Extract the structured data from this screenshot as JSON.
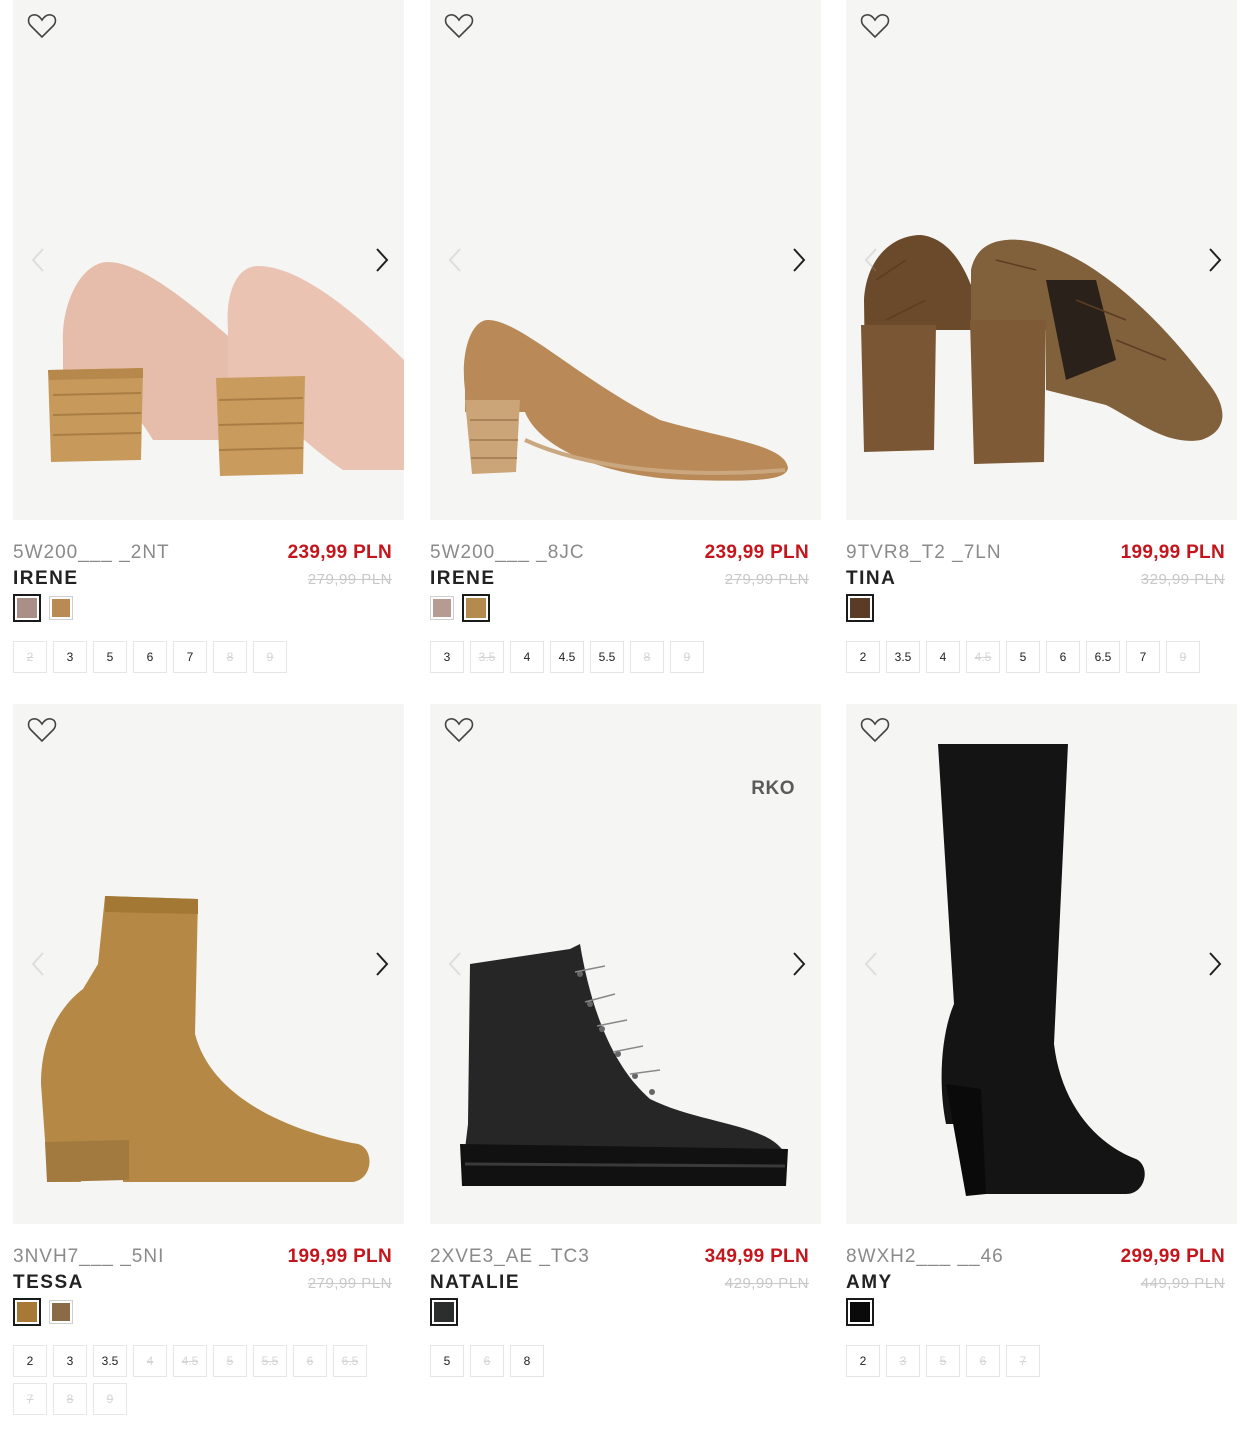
{
  "products": [
    {
      "code": "5W200___ _2NT",
      "name": "IRENE",
      "price": "239,99 PLN",
      "old_price": "279,99 PLN",
      "brand_badge": "",
      "swatches": [
        {
          "color": "#a98f88",
          "selected": true
        },
        {
          "color": "#b98a53",
          "selected": false
        }
      ],
      "sizes": [
        {
          "label": "2",
          "available": false
        },
        {
          "label": "3",
          "available": true
        },
        {
          "label": "5",
          "available": true
        },
        {
          "label": "6",
          "available": true
        },
        {
          "label": "7",
          "available": true
        },
        {
          "label": "8",
          "available": false
        },
        {
          "label": "9",
          "available": false
        }
      ]
    },
    {
      "code": "5W200___ _8JC",
      "name": "IRENE",
      "price": "239,99 PLN",
      "old_price": "279,99 PLN",
      "brand_badge": "",
      "swatches": [
        {
          "color": "#b69b93",
          "selected": false
        },
        {
          "color": "#b58a4f",
          "selected": true
        }
      ],
      "sizes": [
        {
          "label": "3",
          "available": true
        },
        {
          "label": "3.5",
          "available": false
        },
        {
          "label": "4",
          "available": true
        },
        {
          "label": "4.5",
          "available": true
        },
        {
          "label": "5.5",
          "available": true
        },
        {
          "label": "8",
          "available": false
        },
        {
          "label": "9",
          "available": false
        }
      ]
    },
    {
      "code": "9TVR8_T2 _7LN",
      "name": "TINA",
      "price": "199,99 PLN",
      "old_price": "329,99 PLN",
      "brand_badge": "",
      "swatches": [
        {
          "color": "#5a3b26",
          "selected": true
        }
      ],
      "sizes": [
        {
          "label": "2",
          "available": true
        },
        {
          "label": "3.5",
          "available": true
        },
        {
          "label": "4",
          "available": true
        },
        {
          "label": "4.5",
          "available": false
        },
        {
          "label": "5",
          "available": true
        },
        {
          "label": "6",
          "available": true
        },
        {
          "label": "6.5",
          "available": true
        },
        {
          "label": "7",
          "available": true
        },
        {
          "label": "9",
          "available": false
        }
      ]
    },
    {
      "code": "3NVH7___ _5NI",
      "name": "TESSA",
      "price": "199,99 PLN",
      "old_price": "279,99 PLN",
      "brand_badge": "",
      "swatches": [
        {
          "color": "#a77836",
          "selected": true
        },
        {
          "color": "#8b6a46",
          "selected": false
        }
      ],
      "sizes": [
        {
          "label": "2",
          "available": true
        },
        {
          "label": "3",
          "available": true
        },
        {
          "label": "3.5",
          "available": true
        },
        {
          "label": "4",
          "available": false
        },
        {
          "label": "4.5",
          "available": false
        },
        {
          "label": "5",
          "available": false
        },
        {
          "label": "5.5",
          "available": false
        },
        {
          "label": "6",
          "available": false
        },
        {
          "label": "6.5",
          "available": false
        },
        {
          "label": "7",
          "available": false
        },
        {
          "label": "8",
          "available": false
        },
        {
          "label": "9",
          "available": false
        }
      ]
    },
    {
      "code": "2XVE3_AE _TC3",
      "name": "NATALIE",
      "price": "349,99 PLN",
      "old_price": "429,99 PLN",
      "brand_badge": "RKO",
      "swatches": [
        {
          "color": "#2b2e2c",
          "selected": true
        }
      ],
      "sizes": [
        {
          "label": "5",
          "available": true
        },
        {
          "label": "6",
          "available": false
        },
        {
          "label": "8",
          "available": true
        }
      ]
    },
    {
      "code": "8WXH2___ __46",
      "name": "AMY",
      "price": "299,99 PLN",
      "old_price": "449,99 PLN",
      "brand_badge": "",
      "swatches": [
        {
          "color": "#0a0a0a",
          "selected": true
        }
      ],
      "sizes": [
        {
          "label": "2",
          "available": true
        },
        {
          "label": "3",
          "available": false
        },
        {
          "label": "5",
          "available": false
        },
        {
          "label": "6",
          "available": false
        },
        {
          "label": "7",
          "available": false
        }
      ]
    }
  ],
  "icons": {
    "favorite": "heart-outline-icon",
    "prev": "chevron-left-icon",
    "next": "chevron-right-icon"
  }
}
